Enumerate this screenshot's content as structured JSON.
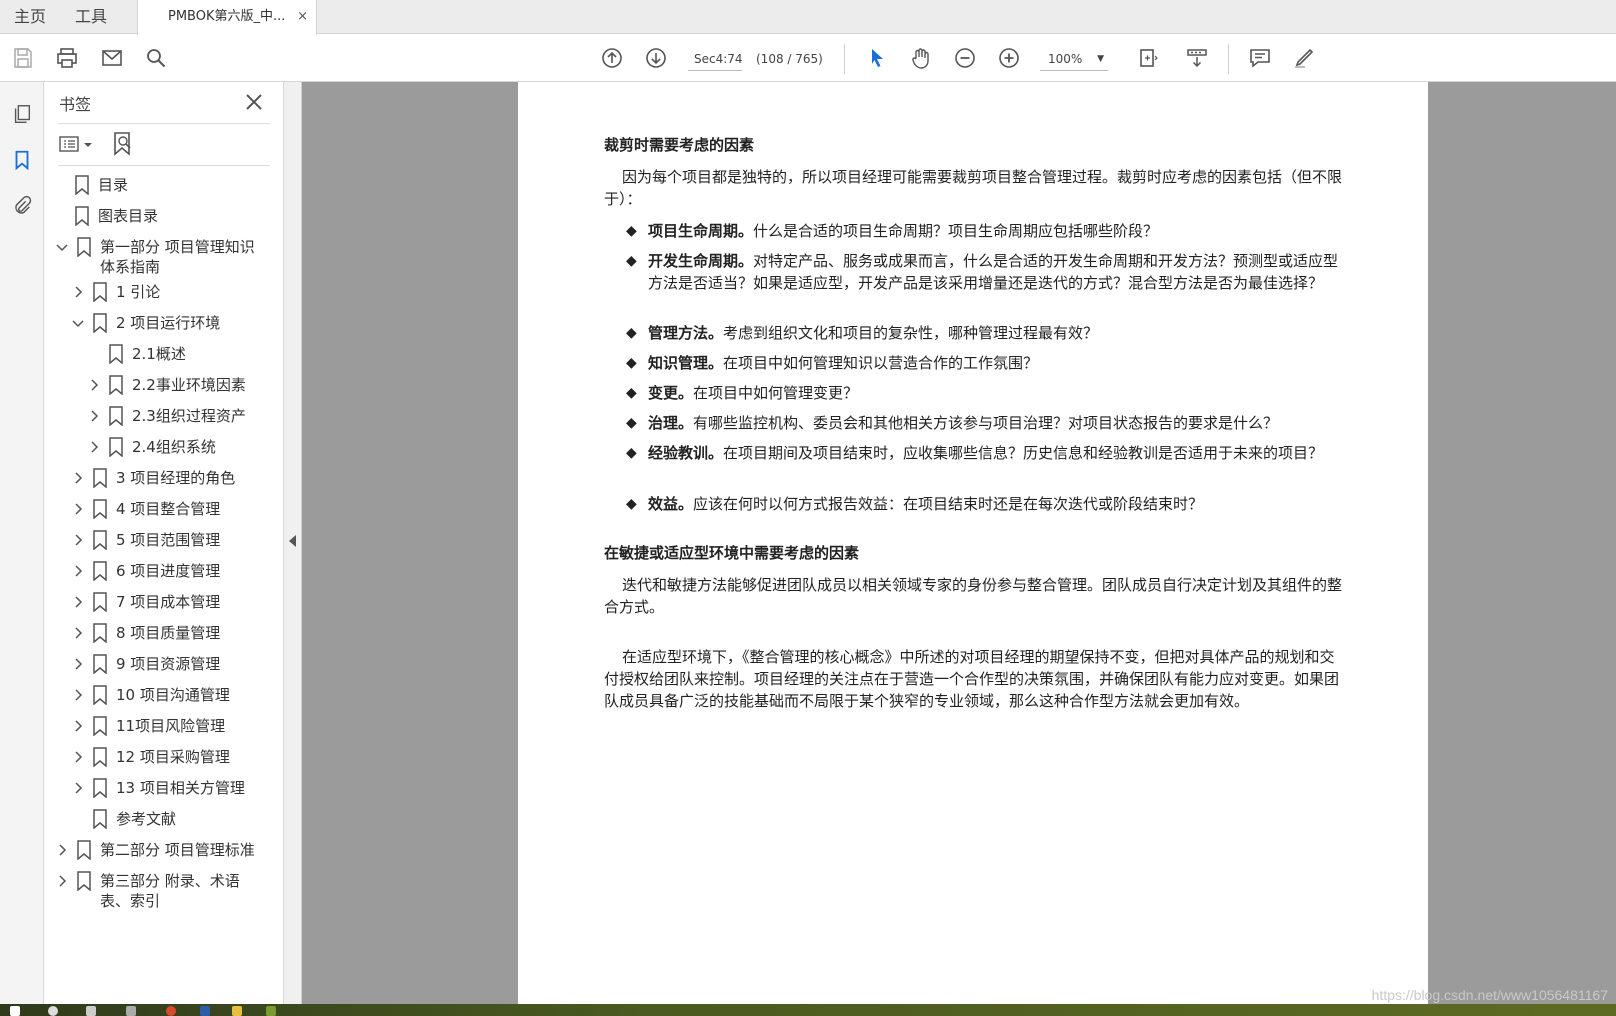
{
  "menubar": {
    "home": "主页",
    "tools": "工具",
    "tab_title": "PMBOK第六版_中...",
    "tab_close": "×"
  },
  "toolbar": {
    "page_label": "Sec4:74",
    "page_count": "(108 / 765)",
    "zoom": "100%"
  },
  "panel": {
    "title": "书签",
    "bookmarks": [
      {
        "label": "目录"
      },
      {
        "label": "图表目录"
      },
      {
        "label": "第一部分 项目管理知识体系指南"
      },
      {
        "label": "1 引论"
      },
      {
        "label": "2 项目运行环境"
      },
      {
        "label": "2.1概述"
      },
      {
        "label": "2.2事业环境因素"
      },
      {
        "label": "2.3组织过程资产"
      },
      {
        "label": "2.4组织系统"
      },
      {
        "label": "3 项目经理的角色"
      },
      {
        "label": "4 项目整合管理"
      },
      {
        "label": "5 项目范围管理"
      },
      {
        "label": "6 项目进度管理"
      },
      {
        "label": "7 项目成本管理"
      },
      {
        "label": "8 项目质量管理"
      },
      {
        "label": "9 项目资源管理"
      },
      {
        "label": "10 项目沟通管理"
      },
      {
        "label": "11项目风险管理"
      },
      {
        "label": "12 项目采购管理"
      },
      {
        "label": "13 项目相关方管理"
      },
      {
        "label": "参考文献"
      },
      {
        "label": "第二部分 项目管理标准"
      },
      {
        "label": "第三部分 附录、术语表、索引"
      }
    ]
  },
  "document": {
    "heading1": "裁剪时需要考虑的因素",
    "intro": "因为每个项目都是独特的，所以项目经理可能需要裁剪项目整合管理过程。裁剪时应考虑的因素包括（但不限于）：",
    "items": [
      {
        "term": "项目生命周期。",
        "text": "什么是合适的项目生命周期？项目生命周期应包括哪些阶段？"
      },
      {
        "term": "开发生命周期。",
        "text": "对特定产品、服务或成果而言，什么是合适的开发生命周期和开发方法？预测型或适应型方法是否适当？如果是适应型，开发产品是该采用增量还是迭代的方式？混合型方法是否为最佳选择？"
      },
      {
        "term": "管理方法。",
        "text": "考虑到组织文化和项目的复杂性，哪种管理过程最有效？"
      },
      {
        "term": "知识管理。",
        "text": "在项目中如何管理知识以营造合作的工作氛围？"
      },
      {
        "term": "变更。",
        "text": "在项目中如何管理变更？"
      },
      {
        "term": "治理。",
        "text": "有哪些监控机构、委员会和其他相关方该参与项目治理？对项目状态报告的要求是什么？"
      },
      {
        "term": "经验教训。",
        "text": "在项目期间及项目结束时，应收集哪些信息？历史信息和经验教训是否适用于未来的项目？"
      },
      {
        "term": "效益。",
        "text": "应该在何时以何方式报告效益：在项目结束时还是在每次迭代或阶段结束时？"
      }
    ],
    "heading2": "在敏捷或适应型环境中需要考虑的因素",
    "para1": "迭代和敏捷方法能够促进团队成员以相关领域专家的身份参与整合管理。团队成员自行决定计划及其组件的整合方式。",
    "para2": "在适应型环境下，《整合管理的核心概念》中所述的对项目经理的期望保持不变，但把对具体产品的规划和交付授权给团队来控制。项目经理的关注点在于营造一个合作型的决策氛围，并确保团队有能力应对变更。如果团队成员具备广泛的技能基础而不局限于某个狭窄的专业领域，那么这种合作型方法就会更加有效。"
  },
  "watermark": "https://blog.csdn.net/www1056481167"
}
